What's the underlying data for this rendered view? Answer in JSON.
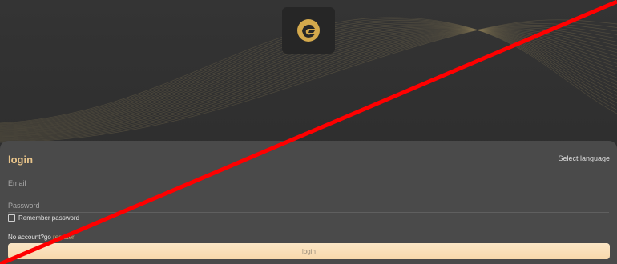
{
  "header": {
    "logo_icon": "brand-logo-icon",
    "logo_color": "#d4a94c"
  },
  "login_form": {
    "title": "login",
    "language_label": "Select language",
    "email_placeholder": "Email",
    "email_value": "",
    "password_placeholder": "Password",
    "password_value": "",
    "remember_label": "Remember password",
    "remember_checked": false,
    "no_account_text": "No account?go ",
    "register_link": "register",
    "submit_label": "login"
  },
  "colors": {
    "title_accent": "#e8c48a",
    "button_bg": "#f8d9ac",
    "panel_bg": "#4a4a4a",
    "overlay_line": "#ff0000"
  },
  "overlay": {
    "icon": "red-diagonal-slash"
  }
}
